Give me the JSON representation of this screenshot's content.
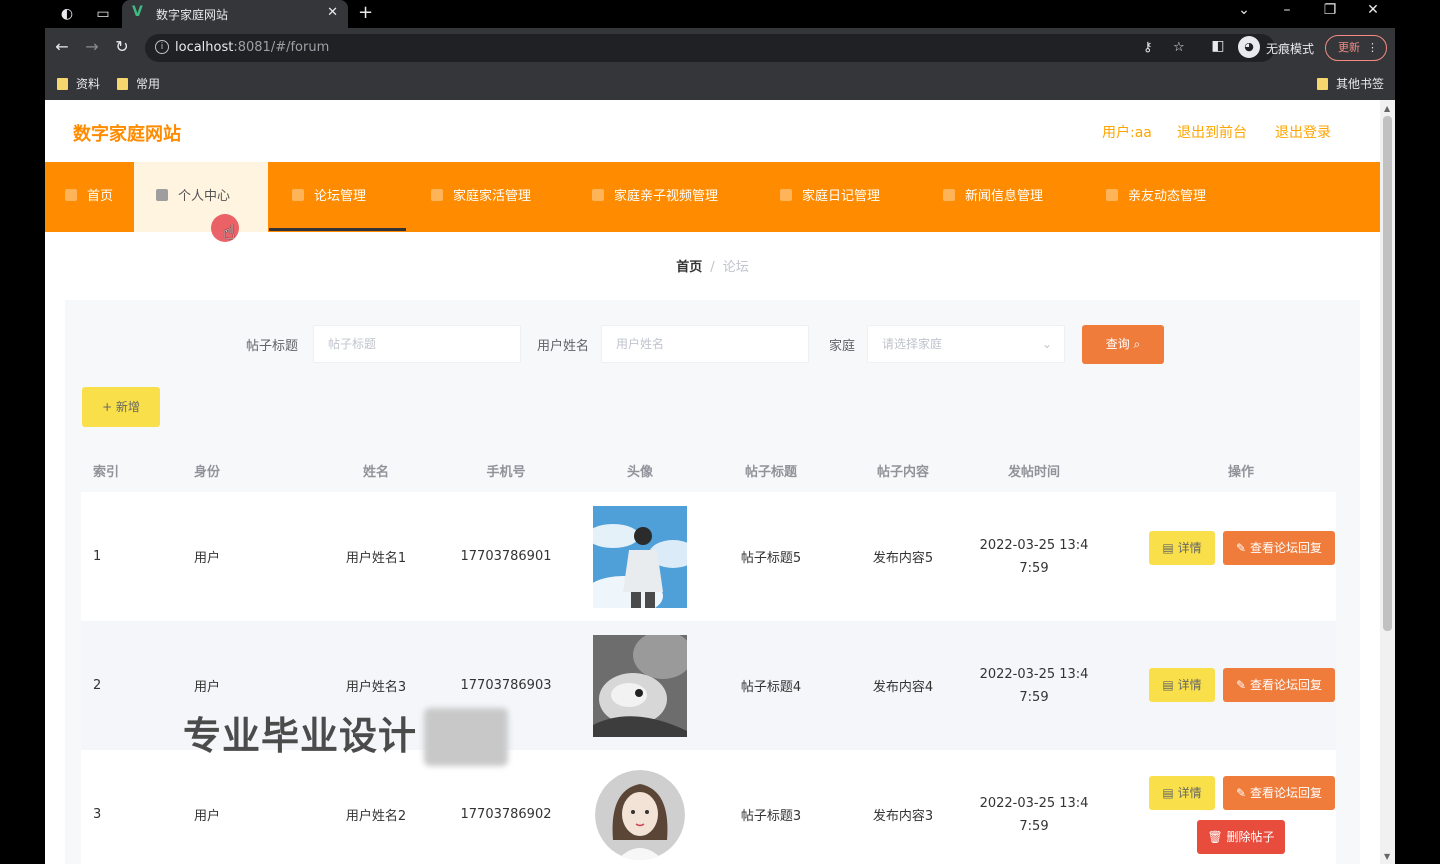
{
  "browser": {
    "tab_title": "数字家庭网站",
    "url_host": "localhost",
    "url_rest": ":8081/#/forum",
    "incognito_label": "无痕模式",
    "update_label": "更新",
    "bookmarks": [
      {
        "label": "资料"
      },
      {
        "label": "常用"
      }
    ],
    "other_bookmarks": "其他书签"
  },
  "header": {
    "brand": "数字家庭网站",
    "user_label": "用户:aa",
    "back_to_front": "退出到前台",
    "logout": "退出登录"
  },
  "menu": [
    {
      "label": "首页"
    },
    {
      "label": "个人中心"
    },
    {
      "label": "论坛管理"
    },
    {
      "label": "家庭家活管理"
    },
    {
      "label": "家庭亲子视频管理"
    },
    {
      "label": "家庭日记管理"
    },
    {
      "label": "新闻信息管理"
    },
    {
      "label": "亲友动态管理"
    }
  ],
  "breadcrumb": {
    "home": "首页",
    "separator": "/",
    "current": "论坛"
  },
  "search": {
    "title_label": "帖子标题",
    "title_placeholder": "帖子标题",
    "username_label": "用户姓名",
    "username_placeholder": "用户姓名",
    "family_label": "家庭",
    "family_placeholder": "请选择家庭",
    "query_button": "查询"
  },
  "add_button": "+ 新增",
  "table": {
    "columns": [
      "索引",
      "身份",
      "姓名",
      "手机号",
      "头像",
      "帖子标题",
      "帖子内容",
      "发帖时间",
      "操作"
    ],
    "rows": [
      {
        "index": "1",
        "role": "用户",
        "name": "用户姓名1",
        "phone": "17703786901",
        "title": "帖子标题5",
        "content": "发布内容5",
        "time_line1": "2022-03-25 13:4",
        "time_line2": "7:59"
      },
      {
        "index": "2",
        "role": "用户",
        "name": "用户姓名3",
        "phone": "17703786903",
        "title": "帖子标题4",
        "content": "发布内容4",
        "time_line1": "2022-03-25 13:4",
        "time_line2": "7:59"
      },
      {
        "index": "3",
        "role": "用户",
        "name": "用户姓名2",
        "phone": "17703786902",
        "title": "帖子标题3",
        "content": "发布内容3",
        "time_line1": "2022-03-25 13:4",
        "time_line2": "7:59"
      }
    ],
    "detail_button": "详情",
    "view_replies_button": "查看论坛回复",
    "delete_button": "删除帖子"
  },
  "watermark": "专业毕业设计",
  "colors": {
    "brand_orange": "#ff8c00",
    "query_orange": "#f07c3c",
    "yellow_button": "#f9e04b",
    "delete_red": "#e84c3d"
  }
}
